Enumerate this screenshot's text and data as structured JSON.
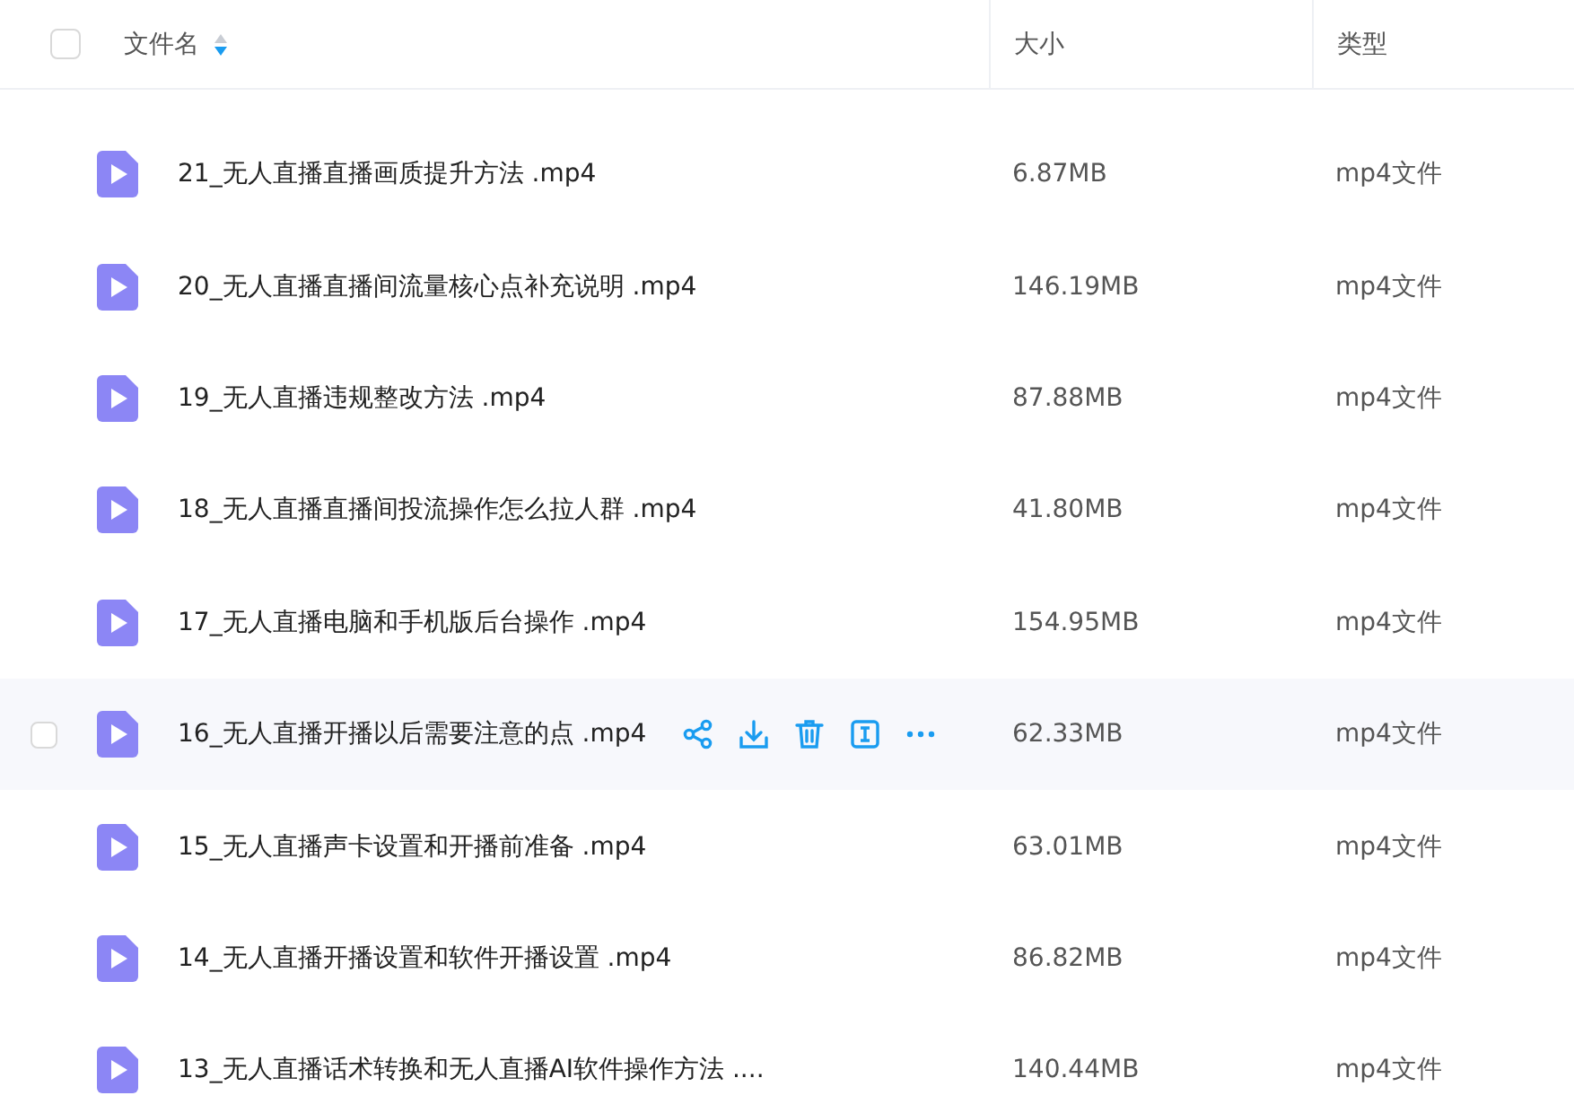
{
  "header": {
    "select_all_checked": false,
    "columns": [
      {
        "label": "文件名",
        "sortable": true
      },
      {
        "label": "大小"
      },
      {
        "label": "类型"
      }
    ]
  },
  "rows": [
    {
      "name": "21_无人直播直播画质提升方法 .mp4",
      "size": "6.87MB",
      "type": "mp4文件",
      "hovered": false
    },
    {
      "name": "20_无人直播直播间流量核心点补充说明 .mp4",
      "size": "146.19MB",
      "type": "mp4文件",
      "hovered": false
    },
    {
      "name": "19_无人直播违规整改方法 .mp4",
      "size": "87.88MB",
      "type": "mp4文件",
      "hovered": false
    },
    {
      "name": "18_无人直播直播间投流操作怎么拉人群 .mp4",
      "size": "41.80MB",
      "type": "mp4文件",
      "hovered": false
    },
    {
      "name": "17_无人直播电脑和手机版后台操作 .mp4",
      "size": "154.95MB",
      "type": "mp4文件",
      "hovered": false
    },
    {
      "name": "16_无人直播开播以后需要注意的点 .mp4",
      "size": "62.33MB",
      "type": "mp4文件",
      "hovered": true
    },
    {
      "name": "15_无人直播声卡设置和开播前准备 .mp4",
      "size": "63.01MB",
      "type": "mp4文件",
      "hovered": false
    },
    {
      "name": "14_无人直播开播设置和软件开播设置 .mp4",
      "size": "86.82MB",
      "type": "mp4文件",
      "hovered": false
    },
    {
      "name": "13_无人直播话术转换和无人直播AI软件操作方法 ....",
      "size": "140.44MB",
      "type": "mp4文件",
      "hovered": false
    }
  ]
}
